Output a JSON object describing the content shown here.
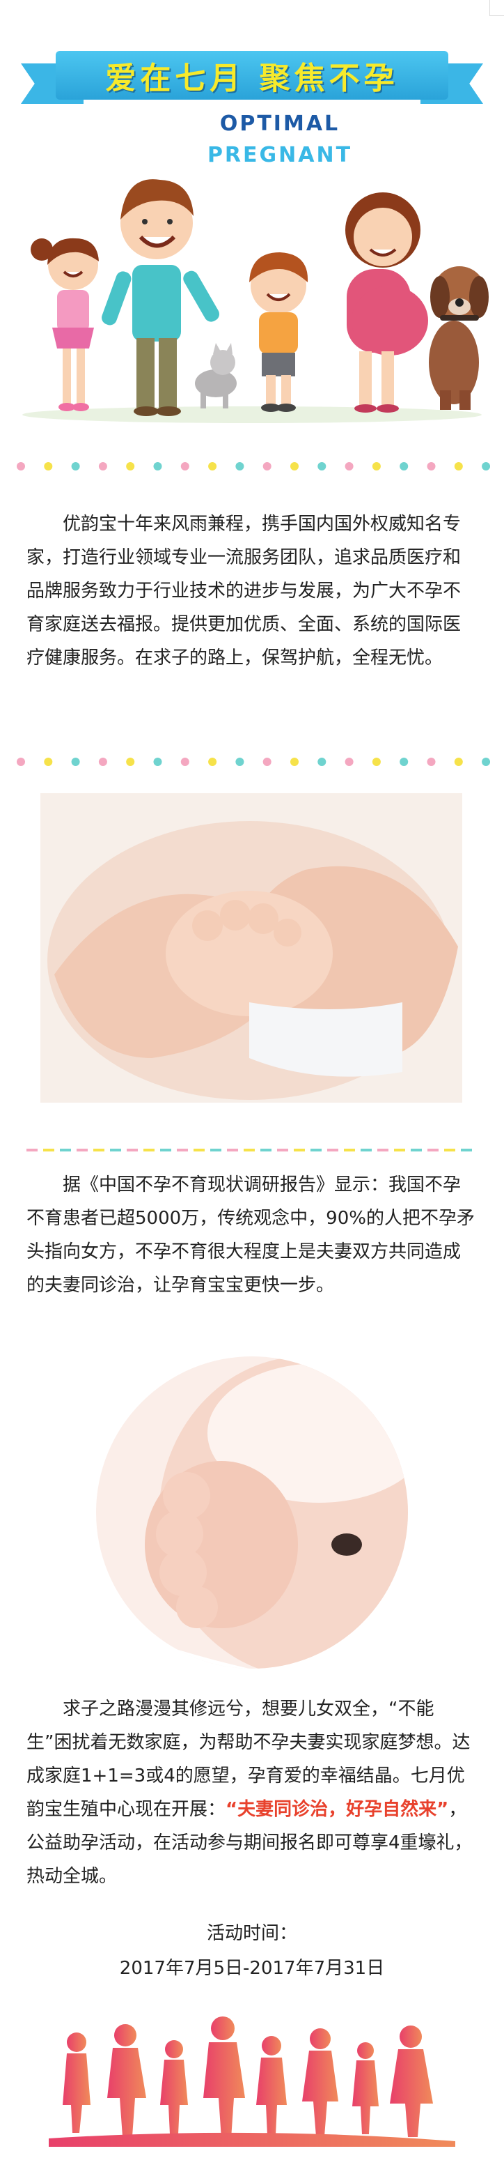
{
  "banner": {
    "title": "爱在七月 聚焦不孕",
    "subtitle_line1": "OPTIMAL",
    "subtitle_line2": "PREGNANT"
  },
  "paragraphs": {
    "p1": "优韵宝十年来风雨兼程，携手国内国外权威知名专家，打造行业领域专业一流服务团队，追求品质医疗和品牌服务致力于行业技术的进步与发展，为广大不孕不育家庭送去福报。提供更加优质、全面、系统的国际医疗健康服务。在求子的路上，保驾护航，全程无忧。",
    "p2": "据《中国不孕不育现状调研报告》显示：我国不孕不育患者已超5000万，传统观念中，90%的人把不孕矛头指向女方，不孕不育很大程度上是夫妻双方共同造成的夫妻同诊治，让孕育宝宝更快一步。",
    "p3_before": "求子之路漫漫其修远兮，想要儿女双全，“不能生”困扰着无数家庭，为帮助不孕夫妻实现家庭梦想。达成家庭1+1=3或4的愿望，孕育爱的幸福结晶。七月优韵宝生殖中心现在开展：",
    "p3_highlight": "“夫妻同诊治，好孕自然来”",
    "p3_after": "，公益助孕活动，在活动参与期间报名即可尊享4重壕礼，热动全城。"
  },
  "activity": {
    "label": "活动时间：",
    "dates": "2017年7月5日-2017年7月31日"
  },
  "colors": {
    "dot_pink": "#f4a7c0",
    "dot_yellow": "#f6e24a",
    "dot_teal": "#6fd3cf",
    "highlight": "#e8412c",
    "ribbon": "#3bb6e6"
  },
  "icons": {
    "family_illustration": "cartoon-family-icon",
    "silhouette": "family-silhouette-icon"
  }
}
